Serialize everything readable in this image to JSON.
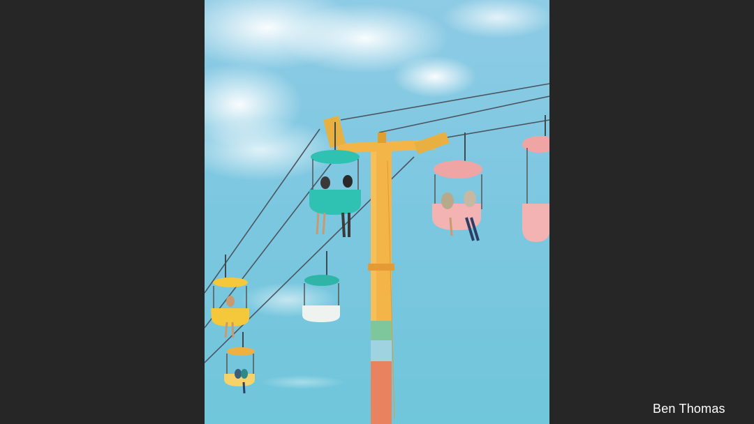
{
  "slide": {
    "background": "#262626",
    "credit": "Ben Thomas"
  },
  "photo": {
    "sky_top": "#8fcbe6",
    "sky_bottom": "#6cc4dc",
    "tower_colors": [
      "#f3b548",
      "#f0a640",
      "#7ec79d",
      "#e8825f"
    ],
    "gondola_colors": {
      "teal": "#2fc1b2",
      "yellow": "#f5c73a",
      "pink": "#f0b0b4"
    }
  }
}
